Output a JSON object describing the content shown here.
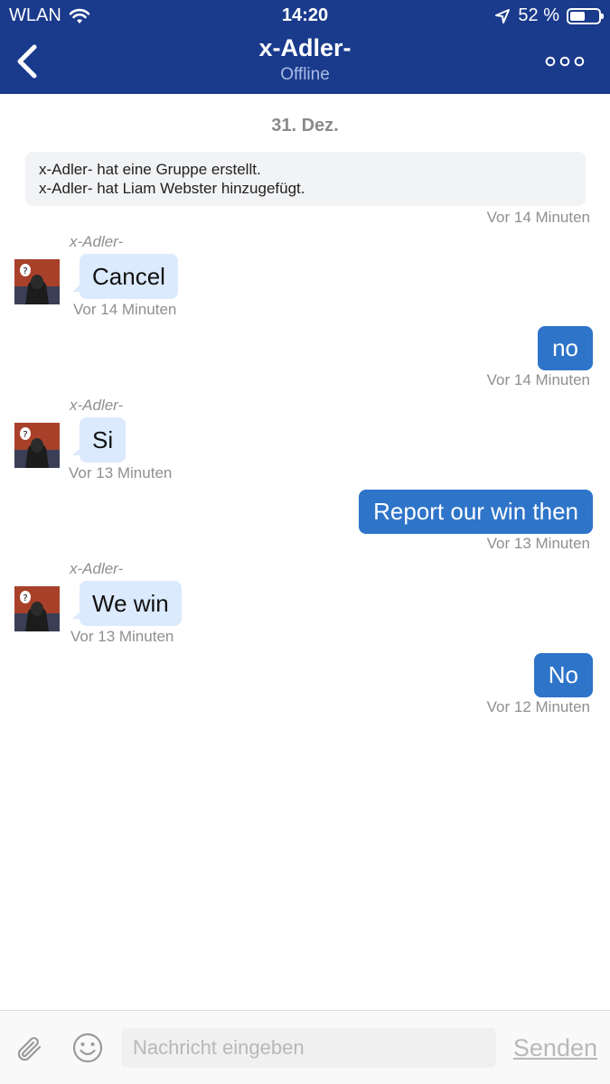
{
  "status_bar": {
    "carrier": "WLAN",
    "time": "14:20",
    "battery": "52 %",
    "battery_level": 0.52
  },
  "header": {
    "title": "x-Adler-",
    "subtitle": "Offline",
    "back_icon": "chevron-left-icon",
    "more_icon": "more-dots-icon"
  },
  "chat": {
    "date": "31. Dez.",
    "system": {
      "lines": [
        "x-Adler- hat eine Gruppe erstellt.",
        "x-Adler- hat Liam Webster hinzugefügt."
      ],
      "time": "Vor 14 Minuten"
    },
    "messages": [
      {
        "direction": "in",
        "sender": "x-Adler-",
        "text": "Cancel",
        "time": "Vor 14 Minuten"
      },
      {
        "direction": "out",
        "text": "no",
        "time": "Vor 14 Minuten"
      },
      {
        "direction": "in",
        "sender": "x-Adler-",
        "text": "Si",
        "time": "Vor 13 Minuten"
      },
      {
        "direction": "out",
        "text": "Report our win then",
        "time": "Vor 13 Minuten"
      },
      {
        "direction": "in",
        "sender": "x-Adler-",
        "text": "We win",
        "time": "Vor 13 Minuten"
      },
      {
        "direction": "out",
        "text": "No",
        "time": "Vor 12 Minuten"
      }
    ]
  },
  "composer": {
    "placeholder": "Nachricht eingeben",
    "send_label": "Senden",
    "attach_icon": "paperclip-icon",
    "emoji_icon": "smiley-icon"
  },
  "colors": {
    "header": "#1a3a8c",
    "incoming_bubble": "#dbeafc",
    "outgoing_bubble": "#2e74c9"
  }
}
